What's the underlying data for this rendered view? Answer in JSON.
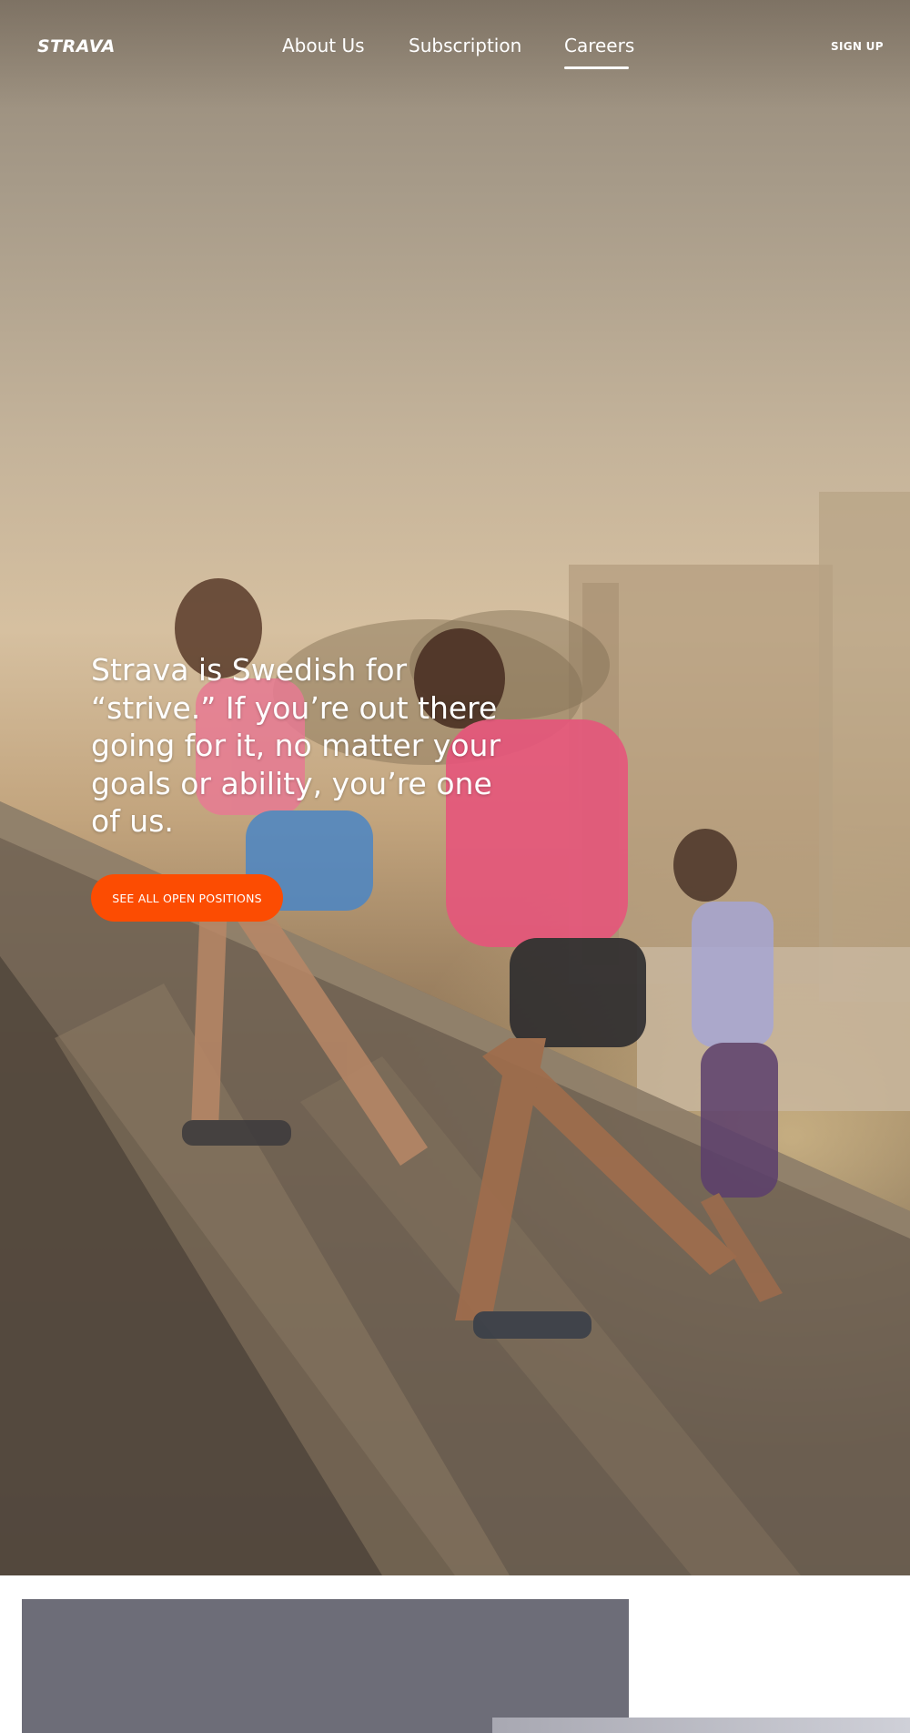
{
  "brand": {
    "logo_text": "STRAVA"
  },
  "nav": {
    "items": [
      {
        "label": "About Us",
        "active": false
      },
      {
        "label": "Subscription",
        "active": false
      },
      {
        "label": "Careers",
        "active": true
      }
    ],
    "signup_label": "SIGN UP"
  },
  "hero": {
    "headline": "Strava is Swedish for “strive.” If you’re out there going for it, no matter your goals or ability, you’re one of us.",
    "cta_label": "SEE ALL OPEN POSITIONS",
    "image": "runners-climbing-stairs-at-sunrise"
  },
  "colors": {
    "accent": "#fc4c02",
    "card_gray": "#6d6d78",
    "text_on_dark": "#ffffff"
  }
}
